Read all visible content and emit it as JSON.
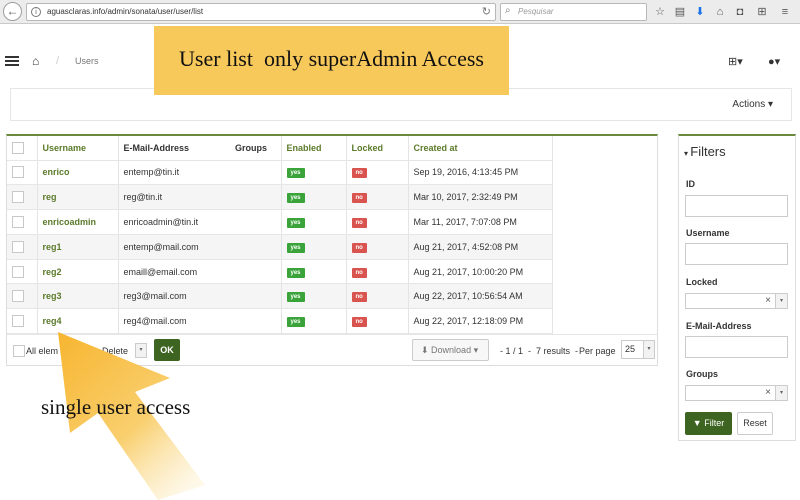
{
  "browser": {
    "url": "aguasclaras.info/admin/sonata/user/user/list",
    "search_placeholder": "Pesquisar"
  },
  "header": {
    "breadcrumb_sep": "/",
    "breadcrumb_current": "Users"
  },
  "annotations": {
    "banner": "User list  only superAdmin Access",
    "caption": "single user access",
    "colors": {
      "highlight": "#f7c85a",
      "arrow": "#f9c24a"
    }
  },
  "actions": {
    "label": "Actions ▾"
  },
  "table": {
    "headers": {
      "username": "Username",
      "email": "E-Mail-Address",
      "groups": "Groups",
      "enabled": "Enabled",
      "locked": "Locked",
      "created_at": "Created at"
    },
    "rows": [
      {
        "username": "enrico",
        "email": "entemp@tin.it",
        "enabled": "yes",
        "locked": "no",
        "created_at": "Sep 19, 2016, 4:13:45 PM",
        "action": "-"
      },
      {
        "username": "reg",
        "email": "reg@tin.it",
        "enabled": "yes",
        "locked": "no",
        "created_at": "Mar 10, 2017, 2:32:49 PM",
        "action": "-"
      },
      {
        "username": "enricoadmin",
        "email": "enricoadmin@tin.it",
        "enabled": "yes",
        "locked": "no",
        "created_at": "Mar 11, 2017, 7:07:08 PM",
        "action": "-"
      },
      {
        "username": "reg1",
        "email": "entemp@mail.com",
        "enabled": "yes",
        "locked": "no",
        "created_at": "Aug 21, 2017, 4:52:08 PM",
        "action": "-"
      },
      {
        "username": "reg2",
        "email": "emaill@email.com",
        "enabled": "yes",
        "locked": "no",
        "created_at": "Aug 21, 2017, 10:00:20 PM",
        "action": "-"
      },
      {
        "username": "reg3",
        "email": "reg3@mail.com",
        "enabled": "yes",
        "locked": "no",
        "created_at": "Aug 22, 2017, 10:56:54 AM",
        "action": "-"
      },
      {
        "username": "reg4",
        "email": "reg4@mail.com",
        "enabled": "yes",
        "locked": "no",
        "created_at": "Aug 22, 2017, 12:18:09 PM",
        "action": "-"
      }
    ],
    "colors": {
      "header_text": "#5b7a2a",
      "yes_badge": "#3aa33a",
      "no_badge": "#d9534f"
    }
  },
  "footer": {
    "all_elements": "All elem",
    "batch_action": "Delete",
    "ok": "OK",
    "download": "Download ▾",
    "pagination": "- 1 / 1  -  7 results  -",
    "per_page_label": "Per page",
    "per_page_value": "25"
  },
  "filters": {
    "title": "Filters",
    "fields": {
      "id": "ID",
      "username": "Username",
      "locked": "Locked",
      "email": "E-Mail-Address",
      "groups": "Groups"
    },
    "filter_button": "Filter",
    "reset_button": "Reset",
    "accent": "#3d6420"
  }
}
